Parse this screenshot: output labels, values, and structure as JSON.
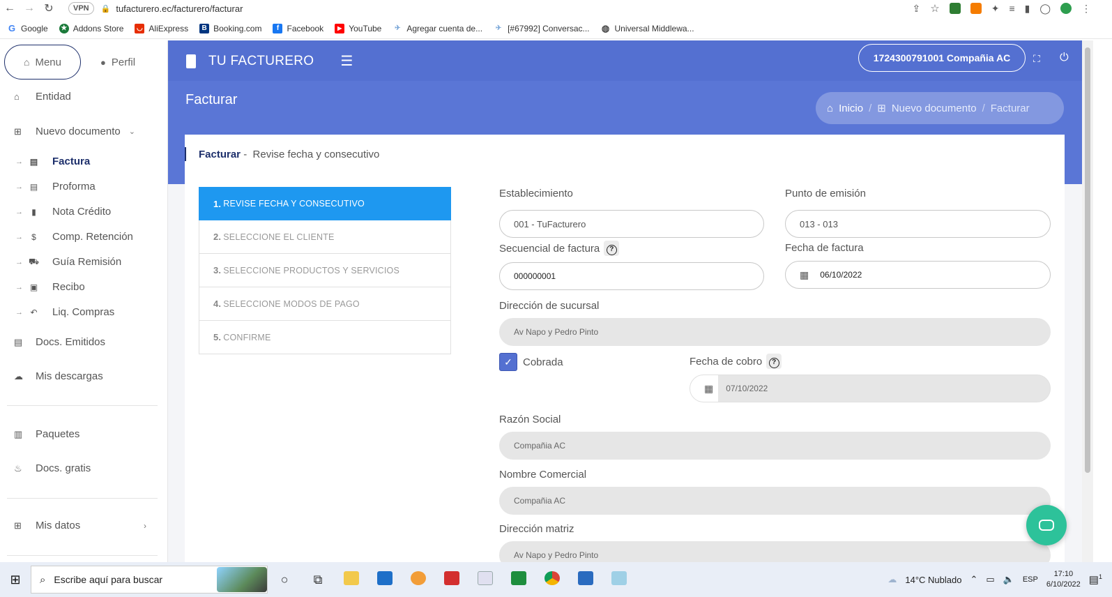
{
  "browser": {
    "url": "tufacturero.ec/facturero/facturar",
    "vpn_label": "VPN",
    "bookmarks": [
      {
        "label": "Google",
        "icon": "google-icon",
        "color": "#4285f4"
      },
      {
        "label": "Addons Store",
        "icon": "addons-store-icon",
        "color": "#1b7a3a"
      },
      {
        "label": "AliExpress",
        "icon": "aliexpress-icon",
        "color": "#e62e04"
      },
      {
        "label": "Booking.com",
        "icon": "booking-icon",
        "color": "#003580"
      },
      {
        "label": "Facebook",
        "icon": "facebook-icon",
        "color": "#1877f2"
      },
      {
        "label": "YouTube",
        "icon": "youtube-icon",
        "color": "#ff0000"
      },
      {
        "label": "Agregar cuenta de...",
        "icon": "bird-icon",
        "color": "#7aa7d8"
      },
      {
        "label": "[#67992] Conversac...",
        "icon": "bird-icon",
        "color": "#7aa7d8"
      },
      {
        "label": "Universal Middlewa...",
        "icon": "globe-icon",
        "color": "#555555"
      }
    ]
  },
  "sidebar": {
    "menu_label": "Menu",
    "perfil_label": "Perfil",
    "entidad": "Entidad",
    "nuevo_documento": "Nuevo documento",
    "sub_items": [
      {
        "label": "Factura",
        "active": true
      },
      {
        "label": "Proforma",
        "active": false
      },
      {
        "label": "Nota Crédito",
        "active": false
      },
      {
        "label": "Comp. Retención",
        "active": false
      },
      {
        "label": "Guía Remisión",
        "active": false
      },
      {
        "label": "Recibo",
        "active": false
      },
      {
        "label": "Liq. Compras",
        "active": false
      }
    ],
    "docs_emitidos": "Docs. Emitidos",
    "mis_descargas": "Mis descargas",
    "paquetes": "Paquetes",
    "docs_gratis": "Docs. gratis",
    "mis_datos": "Mis datos"
  },
  "header": {
    "brand": "TU FACTURERO",
    "company": "1724300791001 Compañia AC",
    "page_title": "Facturar",
    "breadcrumb": {
      "home": "Inicio",
      "middle": "Nuevo documento",
      "current": "Facturar"
    }
  },
  "card": {
    "title": "Facturar",
    "subtitle": "Revise fecha y consecutivo",
    "steps": [
      {
        "num": "1.",
        "label": "REVISE FECHA Y CONSECUTIVO"
      },
      {
        "num": "2.",
        "label": "SELECCIONE EL CLIENTE"
      },
      {
        "num": "3.",
        "label": "SELECCIONE PRODUCTOS Y SERVICIOS"
      },
      {
        "num": "4.",
        "label": "SELECCIONE MODOS DE PAGO"
      },
      {
        "num": "5.",
        "label": "CONFIRME"
      }
    ]
  },
  "form": {
    "establecimiento_label": "Establecimiento",
    "establecimiento_value": "001 - TuFacturero",
    "punto_label": "Punto de emisión",
    "punto_value": "013 - 013",
    "secuencial_label": "Secuencial de factura",
    "secuencial_value": "000000001",
    "fecha_label": "Fecha de factura",
    "fecha_value": "06/10/2022",
    "direccion_sucursal_label": "Dirección de sucursal",
    "direccion_sucursal_value": "Av Napo y Pedro Pinto",
    "cobrada_label": "Cobrada",
    "cobrada_checked": true,
    "fecha_cobro_label": "Fecha de cobro",
    "fecha_cobro_value": "07/10/2022",
    "razon_social_label": "Razón Social",
    "razon_social_value": "Compañia AC",
    "nombre_comercial_label": "Nombre Comercial",
    "nombre_comercial_value": "Compañia AC",
    "direccion_matriz_label": "Dirección matriz",
    "direccion_matriz_value": "Av Napo y Pedro Pinto"
  },
  "taskbar": {
    "search_placeholder": "Escribe aquí para buscar",
    "weather": "14°C  Nublado",
    "lang": "ESP",
    "time": "17:10",
    "date": "6/10/2022",
    "notifications": "1"
  }
}
